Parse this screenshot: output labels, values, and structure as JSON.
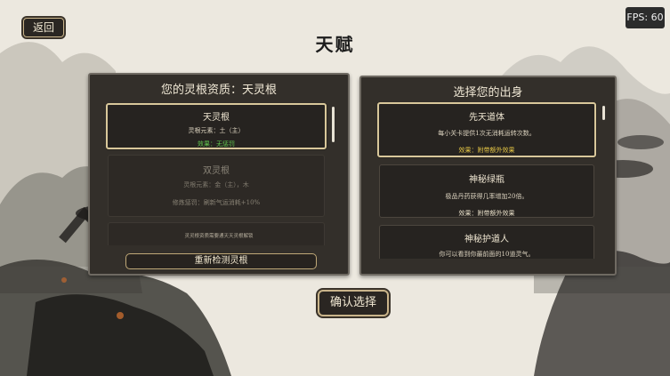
{
  "fps": "FPS: 60",
  "back_label": "返回",
  "title": "天赋",
  "left_panel": {
    "header": "您的灵根资质：天灵根",
    "cards": [
      {
        "name": "天灵根",
        "line1": "灵根元素：土（主）",
        "effect": "效果：无惩罚",
        "effect_color": "#62c74e"
      },
      {
        "name": "双灵根",
        "line1": "灵根元素：金（主），木",
        "effect": "修炼惩罚：刷新气运消耗+10%"
      }
    ],
    "note": "灵灵根资质需要通天天灵根解锁",
    "retest_label": "重新检测灵根"
  },
  "right_panel": {
    "header": "选择您的出身",
    "cards": [
      {
        "name": "先天道体",
        "desc": "每小关卡提供1次无消耗运转次数。",
        "effect": "效果：附带额外效果",
        "effect_color": "#e4c545"
      },
      {
        "name": "神秘绿瓶",
        "desc": "极品丹药获得几率增加20倍。",
        "effect": "效果：附带额外效果"
      },
      {
        "name": "神秘护道人",
        "desc": "你可以看到你最前面的10道灵气。"
      }
    ]
  },
  "confirm_label": "确认选择"
}
